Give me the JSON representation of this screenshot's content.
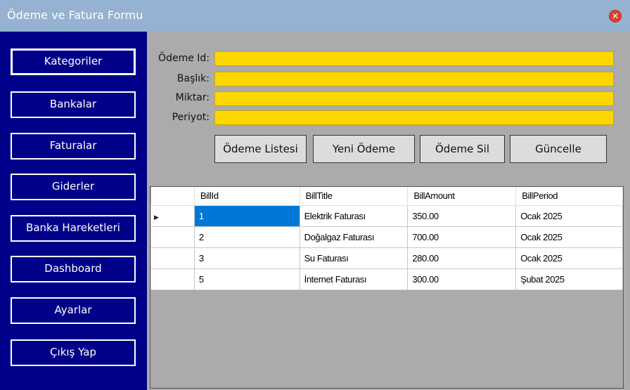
{
  "window": {
    "title": "Ödeme ve Fatura Formu"
  },
  "sidebar": {
    "items": [
      {
        "label": "Kategoriler"
      },
      {
        "label": "Bankalar"
      },
      {
        "label": "Faturalar"
      },
      {
        "label": "Giderler"
      },
      {
        "label": "Banka Hareketleri"
      },
      {
        "label": "Dashboard"
      },
      {
        "label": "Ayarlar"
      },
      {
        "label": "Çıkış Yap"
      }
    ]
  },
  "form": {
    "odeme_id_label": "Ödeme Id:",
    "baslik_label": "Başlık:",
    "miktar_label": "Miktar:",
    "periyot_label": "Periyot:",
    "odeme_id_value": "",
    "baslik_value": "",
    "miktar_value": "",
    "periyot_value": ""
  },
  "actions": {
    "list_label": "Ödeme Listesi",
    "new_label": "Yeni Ödeme",
    "delete_label": "Ödeme Sil",
    "update_label": "Güncelle"
  },
  "grid": {
    "columns": [
      "BillId",
      "BillTitle",
      "BillAmount",
      "BillPeriod"
    ],
    "rows": [
      [
        "1",
        "Elektrik Faturası",
        "350.00",
        "Ocak 2025"
      ],
      [
        "2",
        "Doğalgaz Faturası",
        "700.00",
        "Ocak 2025"
      ],
      [
        "3",
        "Su Faturası",
        "280.00",
        "Ocak 2025"
      ],
      [
        "5",
        "İnternet Faturası",
        "300.00",
        "Şubat 2025"
      ]
    ],
    "current_row_glyph": "▶"
  },
  "colors": {
    "sidebar_bg": "#000088",
    "input_bg": "#ffd700",
    "selection": "#0078d7",
    "titlebar": "#96b2d2"
  }
}
